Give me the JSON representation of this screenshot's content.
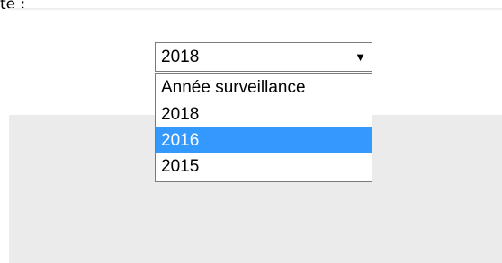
{
  "caption": {
    "fragment": "te :"
  },
  "select": {
    "value": "2018",
    "arrow_icon": "triangle-down-icon",
    "arrow_glyph": "▼"
  },
  "dropdown": {
    "highlighted_index": 2,
    "highlight_color": "#3399ff",
    "options": [
      {
        "label": "Année surveillance"
      },
      {
        "label": "2018"
      },
      {
        "label": "2016"
      },
      {
        "label": "2015"
      }
    ]
  }
}
